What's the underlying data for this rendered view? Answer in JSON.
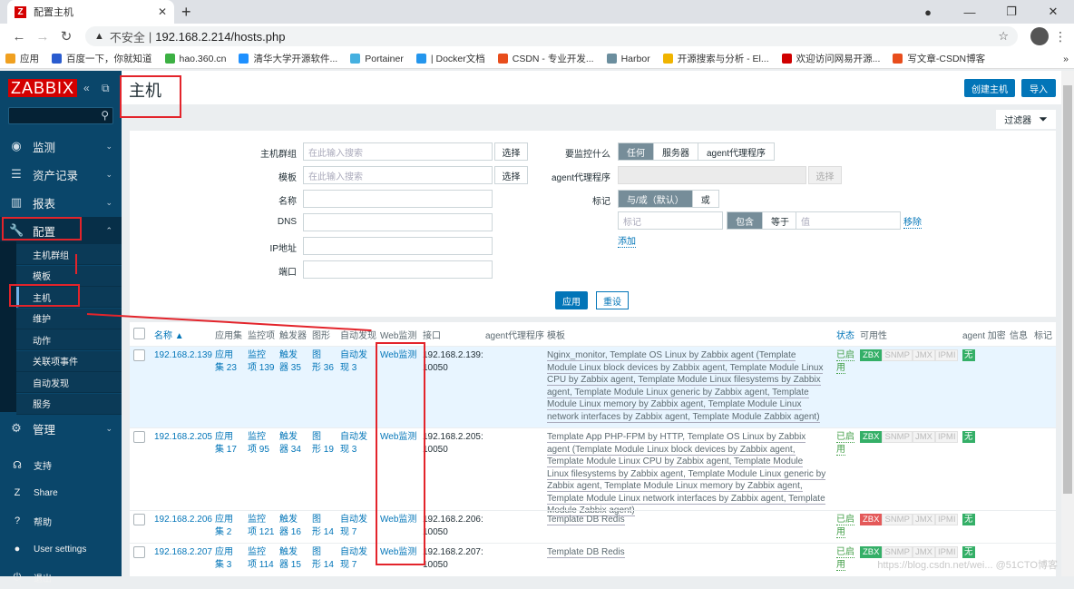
{
  "browser": {
    "tab_title": "配置主机",
    "favicon": "Z",
    "insecure_label": "不安全",
    "url": "192.168.2.214/hosts.php",
    "bookmarks": [
      {
        "label": "应用",
        "color": "#f0a020"
      },
      {
        "label": "百度一下，你就知道",
        "color": "#2a5ccf"
      },
      {
        "label": "hao.360.cn",
        "color": "#3cb043"
      },
      {
        "label": "清华大学开源软件...",
        "color": "#1e90ff"
      },
      {
        "label": "Portainer",
        "color": "#45b0e0"
      },
      {
        "label": "| Docker文档",
        "color": "#2496ed"
      },
      {
        "label": "CSDN - 专业开发...",
        "color": "#e84d1c"
      },
      {
        "label": "Harbor",
        "color": "#6b8e9e"
      },
      {
        "label": "开源搜索与分析 - El...",
        "color": "#f0b400"
      },
      {
        "label": "欢迎访问网易开源...",
        "color": "#d00000"
      },
      {
        "label": "写文章-CSDN博客",
        "color": "#e84d1c"
      }
    ],
    "more_bookmarks": "»"
  },
  "sidebar": {
    "logo": "ZABBIX",
    "menu": [
      {
        "label": "监测",
        "icon": "eye-icon",
        "glyph": "◉"
      },
      {
        "label": "资产记录",
        "icon": "list-icon",
        "glyph": "☰"
      },
      {
        "label": "报表",
        "icon": "chart-icon",
        "glyph": "▥"
      },
      {
        "label": "配置",
        "icon": "wrench-icon",
        "glyph": "🔧"
      },
      {
        "label": "管理",
        "icon": "gear-icon",
        "glyph": "⚙"
      }
    ],
    "config_sub": [
      "主机群组",
      "模板",
      "主机",
      "维护",
      "动作",
      "关联项事件",
      "自动发现",
      "服务"
    ],
    "bottom": [
      {
        "label": "支持",
        "icon": "headset-icon",
        "glyph": "☊"
      },
      {
        "label": "Share",
        "icon": "share-icon",
        "glyph": "Z"
      },
      {
        "label": "帮助",
        "icon": "help-icon",
        "glyph": "?"
      },
      {
        "label": "User settings",
        "icon": "user-icon",
        "glyph": "●"
      },
      {
        "label": "退出",
        "icon": "power-icon",
        "glyph": "⏻"
      }
    ]
  },
  "header": {
    "title": "主机",
    "create_button": "创建主机",
    "import_button": "导入",
    "filter_tab": "过滤器"
  },
  "filter": {
    "host_group_label": "主机群组",
    "template_label": "模板",
    "name_label": "名称",
    "dns_label": "DNS",
    "ip_label": "IP地址",
    "port_label": "端口",
    "search_placeholder": "在此输入搜索",
    "select_button": "选择",
    "monitored_by_label": "要监控什么",
    "monitored_by_options": [
      "任何",
      "服务器",
      "agent代理程序"
    ],
    "monitored_by_selected": "任何",
    "proxy_label": "agent代理程序",
    "tags_label": "标记",
    "tags_logic": [
      "与/或（默认）",
      "或"
    ],
    "tag_placeholder": "标记",
    "tag_operator": [
      "包含",
      "等于"
    ],
    "value_placeholder": "值",
    "remove_link": "移除",
    "add_link": "添加",
    "apply_button": "应用",
    "reset_button": "重设"
  },
  "table": {
    "headers": [
      "名称 ▲",
      "应用集",
      "监控项",
      "触发器",
      "图形",
      "自动发现",
      "Web监测",
      "接口",
      "agent代理程序",
      "模板",
      "状态",
      "可用性",
      "agent 加密",
      "信息",
      "标记"
    ],
    "rows": [
      {
        "name": "192.168.2.139",
        "apps": [
          "应用",
          "集 23"
        ],
        "items": [
          "监控",
          "项 139"
        ],
        "triggers": [
          "触发",
          "器 35"
        ],
        "graphs": [
          "图",
          "形 36"
        ],
        "discovery": [
          "自动发",
          "现 3"
        ],
        "web": "Web监测",
        "interface": [
          "192.168.2.139:",
          "10050"
        ],
        "templates": "Nginx_monitor, Template OS Linux by Zabbix agent (Template Module Linux block devices by Zabbix agent, Template Module Linux CPU by Zabbix agent, Template Module Linux filesystems by Zabbix agent, Template Module Linux generic by Zabbix agent, Template Module Linux memory by Zabbix agent, Template Module Linux network interfaces by Zabbix agent, Template Module Zabbix agent)",
        "status": "已启用",
        "zbx": "ok",
        "encryption": "无"
      },
      {
        "name": "192.168.2.205",
        "apps": [
          "应用",
          "集 17"
        ],
        "items": [
          "监控",
          "项 95"
        ],
        "triggers": [
          "触发",
          "器 34"
        ],
        "graphs": [
          "图",
          "形 19"
        ],
        "discovery": [
          "自动发",
          "现 3"
        ],
        "web": "Web监测",
        "interface": [
          "192.168.2.205:",
          "10050"
        ],
        "templates": "Template App PHP-FPM by HTTP, Template OS Linux by Zabbix agent (Template Module Linux block devices by Zabbix agent, Template Module Linux CPU by Zabbix agent, Template Module Linux filesystems by Zabbix agent, Template Module Linux generic by Zabbix agent, Template Module Linux memory by Zabbix agent, Template Module Linux network interfaces by Zabbix agent, Template Module Zabbix agent)",
        "status": "已启用",
        "zbx": "ok",
        "encryption": "无"
      },
      {
        "name": "192.168.2.206",
        "apps": [
          "应用",
          "集 2"
        ],
        "items": [
          "监控",
          "项 121"
        ],
        "triggers": [
          "触发",
          "器 16"
        ],
        "graphs": [
          "图",
          "形 14"
        ],
        "discovery": [
          "自动发",
          "现 7"
        ],
        "web": "Web监测",
        "interface": [
          "192.168.2.206:",
          "10050"
        ],
        "templates": "Template DB Redis",
        "status": "已启用",
        "zbx": "bad",
        "encryption": "无"
      },
      {
        "name": "192.168.2.207",
        "apps": [
          "应用",
          "集 3"
        ],
        "items": [
          "监控",
          "项 114"
        ],
        "triggers": [
          "触发",
          "器 15"
        ],
        "graphs": [
          "图",
          "形 14"
        ],
        "discovery": [
          "自动发",
          "现 7"
        ],
        "web": "Web监测",
        "interface": [
          "192.168.2.207:",
          "10050"
        ],
        "templates": "Template DB Redis",
        "status": "已启用",
        "zbx": "ok",
        "encryption": "无"
      }
    ],
    "availability_labels": [
      "ZBX",
      "SNMP",
      "JMX",
      "IPMI"
    ]
  },
  "watermark": "https://blog.csdn.net/wei... @51CTO博客"
}
